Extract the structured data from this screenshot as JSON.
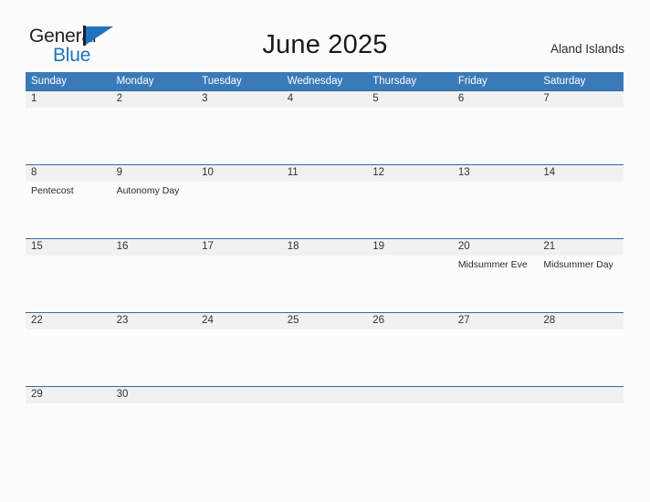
{
  "brand": {
    "name_part1": "General",
    "name_part2": "Blue",
    "flag_icon": "blue-flag-icon"
  },
  "header": {
    "title": "June 2025",
    "region": "Aland Islands"
  },
  "calendar": {
    "weekday_headers": [
      "Sunday",
      "Monday",
      "Tuesday",
      "Wednesday",
      "Thursday",
      "Friday",
      "Saturday"
    ],
    "weeks": [
      [
        {
          "day": "1",
          "event": ""
        },
        {
          "day": "2",
          "event": ""
        },
        {
          "day": "3",
          "event": ""
        },
        {
          "day": "4",
          "event": ""
        },
        {
          "day": "5",
          "event": ""
        },
        {
          "day": "6",
          "event": ""
        },
        {
          "day": "7",
          "event": ""
        }
      ],
      [
        {
          "day": "8",
          "event": "Pentecost"
        },
        {
          "day": "9",
          "event": "Autonomy Day"
        },
        {
          "day": "10",
          "event": ""
        },
        {
          "day": "11",
          "event": ""
        },
        {
          "day": "12",
          "event": ""
        },
        {
          "day": "13",
          "event": ""
        },
        {
          "day": "14",
          "event": ""
        }
      ],
      [
        {
          "day": "15",
          "event": ""
        },
        {
          "day": "16",
          "event": ""
        },
        {
          "day": "17",
          "event": ""
        },
        {
          "day": "18",
          "event": ""
        },
        {
          "day": "19",
          "event": ""
        },
        {
          "day": "20",
          "event": "Midsummer Eve"
        },
        {
          "day": "21",
          "event": "Midsummer Day"
        }
      ],
      [
        {
          "day": "22",
          "event": ""
        },
        {
          "day": "23",
          "event": ""
        },
        {
          "day": "24",
          "event": ""
        },
        {
          "day": "25",
          "event": ""
        },
        {
          "day": "26",
          "event": ""
        },
        {
          "day": "27",
          "event": ""
        },
        {
          "day": "28",
          "event": ""
        }
      ],
      [
        {
          "day": "29",
          "event": ""
        },
        {
          "day": "30",
          "event": ""
        },
        {
          "day": "",
          "event": ""
        },
        {
          "day": "",
          "event": ""
        },
        {
          "day": "",
          "event": ""
        },
        {
          "day": "",
          "event": ""
        },
        {
          "day": "",
          "event": ""
        }
      ]
    ]
  },
  "colors": {
    "header_blue": "#3b7ab8",
    "rule_blue": "#2e6da4",
    "brand_blue": "#1e73be",
    "daynum_band": "#f1f1f1",
    "page_background": "#fcfcfc"
  }
}
